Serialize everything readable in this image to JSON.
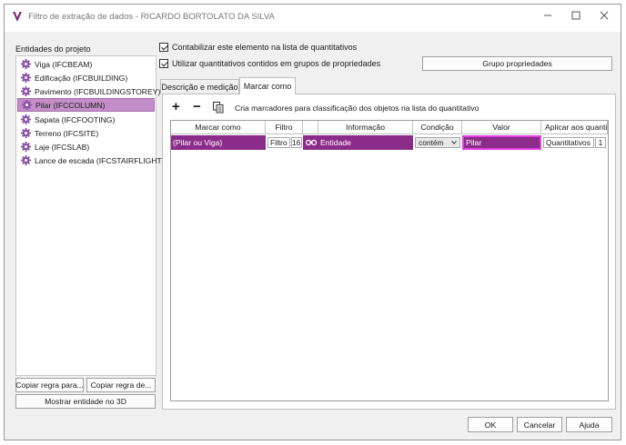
{
  "window": {
    "title": "Filtro de extração de dados - RICARDO BORTOLATO DA SILVA"
  },
  "left": {
    "label": "Entidades do projeto",
    "entities": [
      {
        "label": "Viga (IFCBEAM)",
        "selected": false
      },
      {
        "label": "Edificação (IFCBUILDING)",
        "selected": false
      },
      {
        "label": "Pavimento (IFCBUILDINGSTOREY)",
        "selected": false
      },
      {
        "label": "Pilar (IFCCOLUMN)",
        "selected": true
      },
      {
        "label": "Sapata (IFCFOOTING)",
        "selected": false
      },
      {
        "label": "Terreno (IFCSITE)",
        "selected": false
      },
      {
        "label": "Laje (IFCSLAB)",
        "selected": false
      },
      {
        "label": "Lance de escada (IFCSTAIRFLIGHT)",
        "selected": false
      }
    ],
    "copy_rule_to_label": "Copiar regra para...",
    "copy_rule_from_label": "Copiar regra de...",
    "show_entity_3d_label": "Mostrar entidade no 3D"
  },
  "options": {
    "count_in_list_label": "Contabilizar este elemento na lista de quantitativos",
    "count_in_list_checked": true,
    "use_property_groups_label": "Utilizar quantitativos contidos em grupos de propriedades",
    "use_property_groups_checked": true,
    "property_group_button": "Grupo propriedades"
  },
  "tabs": [
    {
      "label": "Descrição e medição",
      "active": false
    },
    {
      "label": "Marcar como",
      "active": true
    }
  ],
  "marcar": {
    "hint": "Cria marcadores para classificação dos objetos na lista do quantitativo",
    "columns": [
      "Marcar como",
      "Filtro",
      "",
      "Informação",
      "Condição",
      "Valor",
      "Aplicar aos quantit"
    ],
    "rows": [
      {
        "marcar_como": "(Pilar ou Viga)",
        "filtro": "Filtro",
        "filtro_num": "16",
        "informacao": "Entidade",
        "condicao": "contém",
        "valor": "Pilar",
        "aplicar": "Quantitativos",
        "aplicar_num": "1"
      }
    ]
  },
  "footer": {
    "ok": "OK",
    "cancel": "Cancelar",
    "help": "Ajuda"
  },
  "colors": {
    "accent": "#8c2c8a",
    "selection": "#c48fc9",
    "highlight_border": "#e040e0"
  },
  "icons": {
    "logo": "app-logo-icon",
    "entity": "gear-icon",
    "add": "plus-icon",
    "remove": "minus-icon",
    "copy": "copy-icon",
    "link": "link-icon",
    "dropdown": "chevron-down-icon"
  }
}
